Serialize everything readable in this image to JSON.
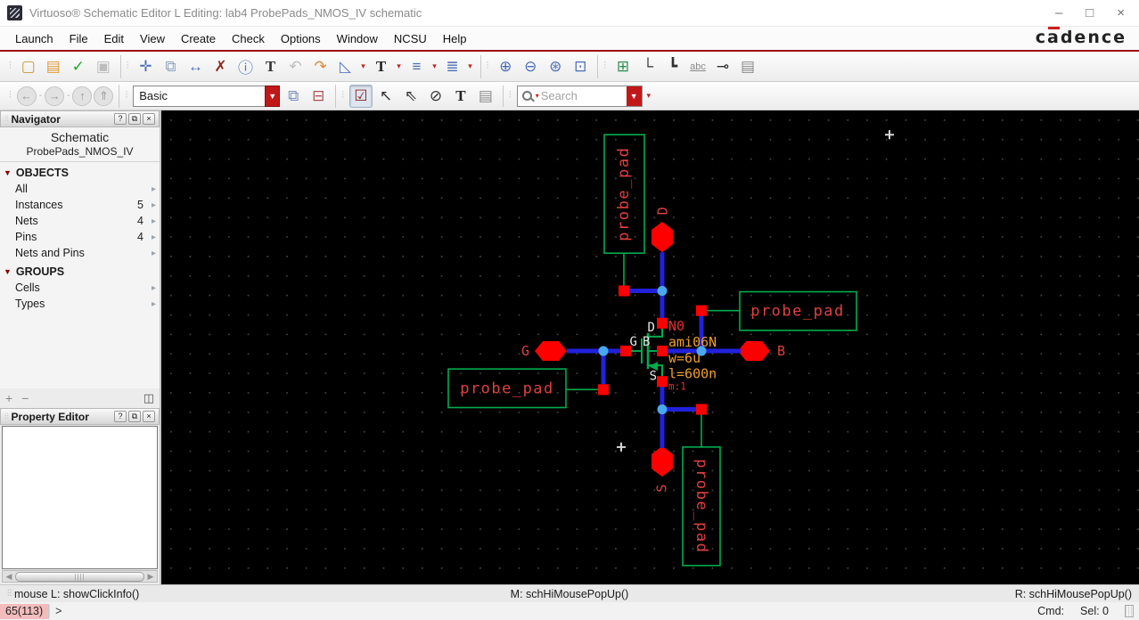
{
  "window": {
    "title": "Virtuoso® Schematic Editor L Editing: lab4 ProbePads_NMOS_IV schematic",
    "minimize": "–",
    "maximize": "□",
    "close": "×"
  },
  "brand": {
    "c": "c",
    "a": "a",
    "rest": "dence"
  },
  "menu": {
    "items": [
      "Launch",
      "File",
      "Edit",
      "View",
      "Create",
      "Check",
      "Options",
      "Window",
      "NCSU",
      "Help"
    ]
  },
  "icons": {
    "chevron": "▸",
    "section_triangle": "▼",
    "dropdown": "▼",
    "dd_small": "▾"
  },
  "t1": [
    {
      "n": "new-file",
      "g": "▢",
      "c": "#c8973a"
    },
    {
      "n": "open-file",
      "g": "▤",
      "c": "#e09a3a"
    },
    {
      "n": "save",
      "g": "✓",
      "c": "#1faa1f"
    },
    {
      "n": "save-alt",
      "g": "▣",
      "c": "#bdbdbd"
    },
    {
      "n": "move",
      "g": "✛",
      "c": "#4a6fb5"
    },
    {
      "n": "copy",
      "g": "⧉",
      "c": "#8fa3c0"
    },
    {
      "n": "stretch",
      "g": "↔",
      "c": "#4a6fb5"
    },
    {
      "n": "delete",
      "g": "✗",
      "c": "#8e2a1e"
    },
    {
      "n": "query-properties",
      "g": "ⓘ",
      "c": "#4a6fb5"
    },
    {
      "n": "edit-labels",
      "g": "T",
      "c": "#333333"
    },
    {
      "n": "undo",
      "g": "↶",
      "c": "#bdbdbd"
    },
    {
      "n": "redo",
      "g": "↷",
      "c": "#e0873a"
    },
    {
      "n": "rotate",
      "g": "◺",
      "c": "#5a7ac0"
    },
    {
      "n": "text-orientation",
      "g": "T",
      "c": "#222222"
    },
    {
      "n": "align",
      "g": "≡",
      "c": "#4a6fb5"
    },
    {
      "n": "distribute",
      "g": "≣",
      "c": "#4a6fb5"
    },
    {
      "n": "zoom-in",
      "g": "⊕",
      "c": "#4a6fb5"
    },
    {
      "n": "zoom-out",
      "g": "⊖",
      "c": "#4a6fb5"
    },
    {
      "n": "zoom-fit",
      "g": "⊛",
      "c": "#4a6fb5"
    },
    {
      "n": "zoom-area",
      "g": "⊡",
      "c": "#4a6fb5"
    },
    {
      "n": "create-instance",
      "g": "⊞",
      "c": "#2f8f4f"
    },
    {
      "n": "create-wire",
      "g": "└",
      "c": "#303030"
    },
    {
      "n": "create-wide-wire",
      "g": "┗",
      "c": "#303030"
    },
    {
      "n": "create-label",
      "g": "abc",
      "c": "#8a8a8a"
    },
    {
      "n": "create-pin",
      "g": "⊸",
      "c": "#303030"
    },
    {
      "n": "object-properties",
      "g": "▤",
      "c": "#8a8a8a"
    }
  ],
  "t2": {
    "nav": [
      {
        "n": "back",
        "g": "←"
      },
      {
        "n": "forward",
        "g": "→"
      },
      {
        "n": "up-hierarchy",
        "g": "↑"
      },
      {
        "n": "top-hierarchy",
        "g": "⇑"
      }
    ],
    "workspace": {
      "value": "Basic"
    },
    "ws_icons": [
      {
        "n": "save-workspace",
        "g": "⧉",
        "c": "#7a90b8"
      },
      {
        "n": "revert-workspace",
        "g": "⊟",
        "c": "#b05050"
      }
    ],
    "select": [
      {
        "n": "mode-full-select",
        "g": "☑",
        "c": "#8b1a1a"
      },
      {
        "n": "mode-partial-select",
        "g": "↖",
        "c": "#333333"
      },
      {
        "n": "mode-single-select",
        "g": "⇖",
        "c": "#333333"
      },
      {
        "n": "mode-deselect",
        "g": "⊘",
        "c": "#333333"
      },
      {
        "n": "mode-text-select",
        "g": "T",
        "c": "#222222"
      },
      {
        "n": "mode-query",
        "g": "▤",
        "c": "#8a8a8a"
      }
    ],
    "search": {
      "placeholder": "Search"
    }
  },
  "navigator": {
    "title": "Navigator",
    "btn_help": "?",
    "btn_float": "⧉",
    "btn_close": "×",
    "view_label": "Schematic",
    "cell_name": "ProbePads_NMOS_IV",
    "objects": {
      "header": "OBJECTS",
      "items": [
        {
          "label": "All",
          "count": ""
        },
        {
          "label": "Instances",
          "count": "5"
        },
        {
          "label": "Nets",
          "count": "4"
        },
        {
          "label": "Pins",
          "count": "4"
        },
        {
          "label": "Nets and Pins",
          "count": ""
        }
      ]
    },
    "groups": {
      "header": "GROUPS",
      "items": [
        {
          "label": "Cells",
          "count": ""
        },
        {
          "label": "Types",
          "count": ""
        }
      ]
    },
    "strip": {
      "add": "+",
      "remove": "−",
      "columns": "◫"
    }
  },
  "prop_editor": {
    "title": "Property Editor",
    "btn_help": "?",
    "btn_float": "⧉",
    "btn_close": "×"
  },
  "schematic": {
    "pads": {
      "top": "probe_pad",
      "left": "probe_pad",
      "right": "probe_pad",
      "bottom": "probe_pad"
    },
    "pins": {
      "d": "D",
      "g": "G",
      "b": "B",
      "s": "S"
    },
    "inst": {
      "name": "N0",
      "model": "ami06N",
      "w": "w=6u",
      "l": "l=600n",
      "m": "m:1",
      "td": "D",
      "tg": "G",
      "tb": "B",
      "ts": "S"
    },
    "colors": {
      "wire": "#2121dc",
      "junction": "#4aa8f0",
      "device": "#00ab4e",
      "pin_fill": "#ff0000",
      "label_red": "#e04040",
      "param_orange": "#f0a028",
      "terminal_white": "#e8e8e8"
    }
  },
  "statusbar": {
    "left": "mouse L: showClickInfo()",
    "middle": "M: schHiMousePopUp()",
    "right": "R: schHiMousePopUp()"
  },
  "cmdline": {
    "counter": "65(113)",
    "prompt": ">",
    "cmd": "Cmd:",
    "sel": "Sel: 0"
  }
}
